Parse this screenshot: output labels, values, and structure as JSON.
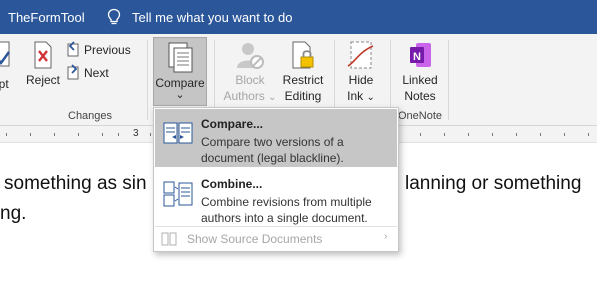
{
  "titlebar": {
    "brand": "TheFormTool",
    "tell_me": "Tell me what you want to do",
    "bg": "#2b579a"
  },
  "ribbon": {
    "accept": {
      "label": "ept"
    },
    "reject": {
      "label": "Reject",
      "arrow": "⌄"
    },
    "previous": {
      "label": "Previous"
    },
    "next": {
      "label": "Next"
    },
    "changes_group": "Changes",
    "compare": {
      "label": "Compare",
      "arrow": "⌄"
    },
    "block_authors": {
      "line1": "Block",
      "line2": "Authors",
      "arrow": "⌄"
    },
    "restrict_editing": {
      "line1": "Restrict",
      "line2": "Editing"
    },
    "hide_ink": {
      "line1": "Hide",
      "line2": "Ink",
      "arrow": "⌄"
    },
    "linked_notes": {
      "line1": "Linked",
      "line2": "Notes"
    },
    "onenote_group": "OneNote"
  },
  "ruler": {
    "number": "3"
  },
  "document": {
    "line1_left": "something as sin",
    "line1_right": "lanning or something",
    "line2": "ng."
  },
  "compare_menu": {
    "compare": {
      "title": "Compare...",
      "desc": "Compare two versions of a document (legal blackline)."
    },
    "combine": {
      "title": "Combine...",
      "desc": "Combine revisions from multiple authors into a single document."
    },
    "show_source": {
      "label": "Show Source Documents",
      "arrow": "›"
    }
  }
}
